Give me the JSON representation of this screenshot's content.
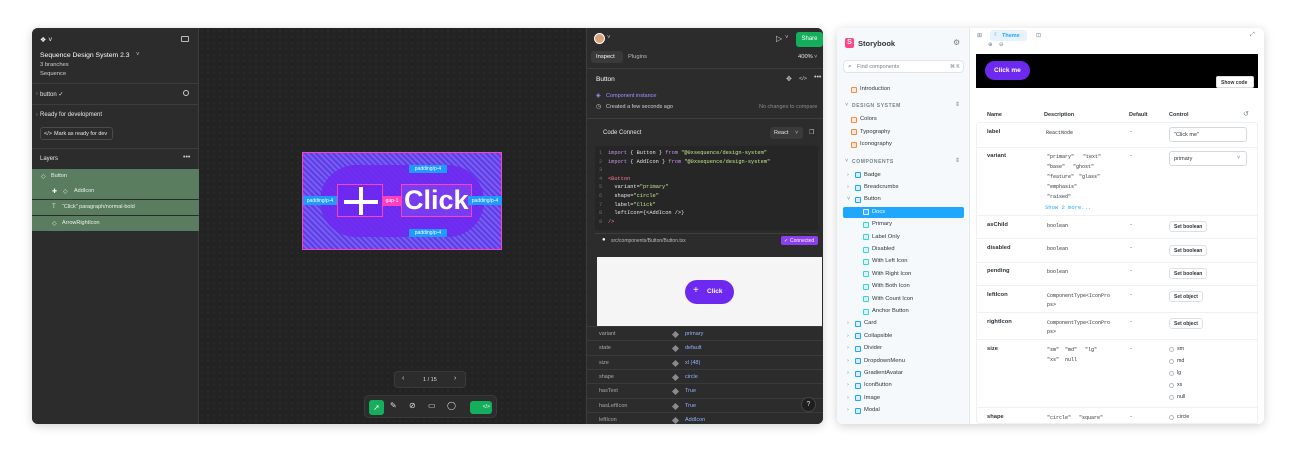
{
  "figma": {
    "file_title": "Sequence Design System 2.3",
    "branches": "3 branches",
    "team": "Sequence",
    "page": "button ✓",
    "ready_title": "Ready for development",
    "mark_ready": "Mark as ready for dev",
    "layers_title": "Layers",
    "layers": [
      "Button",
      "AddIcon",
      "“Click” paragraph/normal-bold",
      "ArrowRightIcon"
    ],
    "canvas": {
      "label_click": "Click",
      "pad_top": "padding/p-4",
      "pad_left": "padding/p-4",
      "pad_right": "padding/p-4",
      "pad_bottom": "padding/p-4",
      "gap": "gap-1",
      "pager": "1 / 15"
    },
    "zoom": "400%",
    "share": "Share",
    "tabs": [
      "Inspect",
      "Plugins"
    ],
    "component": "Button",
    "instance": "Component instance",
    "created": "Created a few seconds ago",
    "no_changes": "No changes to compare",
    "code_connect": "Code Connect",
    "lang": "React",
    "code_lines": [
      {
        "n": "1",
        "parts": [
          [
            "import",
            "#c792ea"
          ],
          [
            " { Button } ",
            "#e6e6e6"
          ],
          [
            "from",
            "#c792ea"
          ],
          [
            " \"@0xsequence/design-system\"",
            "#c3e88d"
          ]
        ]
      },
      {
        "n": "2",
        "parts": [
          [
            "import",
            "#c792ea"
          ],
          [
            " { AddIcon } ",
            "#e6e6e6"
          ],
          [
            "from",
            "#c792ea"
          ],
          [
            " \"@0xsequence/design-system\"",
            "#c3e88d"
          ]
        ]
      },
      {
        "n": "3",
        "parts": []
      },
      {
        "n": "4",
        "parts": [
          [
            "<Button",
            "#ff7b9c"
          ]
        ]
      },
      {
        "n": "5",
        "parts": [
          [
            "  variant=",
            "#e6e6e6"
          ],
          [
            "\"primary\"",
            "#c3e88d"
          ]
        ]
      },
      {
        "n": "6",
        "parts": [
          [
            "  shape=",
            "#e6e6e6"
          ],
          [
            "\"circle\"",
            "#c3e88d"
          ]
        ]
      },
      {
        "n": "7",
        "parts": [
          [
            "  label=",
            "#e6e6e6"
          ],
          [
            "\"Click\"",
            "#c3e88d"
          ]
        ]
      },
      {
        "n": "8",
        "parts": [
          [
            "  leftIcon={<AddIcon />}",
            "#e6e6e6"
          ]
        ]
      },
      {
        "n": "9",
        "parts": [
          [
            "/>",
            "#ff7b9c"
          ]
        ]
      }
    ],
    "source_path": "src/components/Button/Button.tsx",
    "connected": "Connected",
    "preview_label": "Click",
    "props": [
      [
        "variant",
        "primary"
      ],
      [
        "state",
        "default"
      ],
      [
        "size",
        "xl (48)"
      ],
      [
        "shape",
        "circle"
      ],
      [
        "hasText",
        "True"
      ],
      [
        "hasLeftIcon",
        "True"
      ],
      [
        "leftIcon",
        "AddIcon"
      ]
    ]
  },
  "storybook": {
    "brand": "Storybook",
    "search_placeholder": "Find components",
    "shortcut": "⌘ K",
    "introduction": "Introduction",
    "cat_design": "DESIGN SYSTEM",
    "design_items": [
      "Colors",
      "Typography",
      "Iconography"
    ],
    "cat_components": "COMPONENTS",
    "components_before": [
      "Badge",
      "Breadcrumbs",
      "Button"
    ],
    "button_children": [
      "Docs",
      "Primary",
      "Label Only",
      "Disabled",
      "With Left Icon",
      "With Right Icon",
      "With Both Icon",
      "With Count Icon",
      "Anchor Button"
    ],
    "components_after": [
      "Card",
      "Collapsible",
      "Divider",
      "DropdownMenu",
      "GradientAvatar",
      "IconButton",
      "Image",
      "Modal"
    ],
    "theme": "Theme",
    "preview_button": "Click me",
    "show_code": "Show code",
    "headers": [
      "Name",
      "Description",
      "Default",
      "Control"
    ],
    "rows": {
      "label": {
        "name": "label",
        "desc": "ReactNode",
        "def": "-",
        "ctrl": "\"Click me\""
      },
      "variant": {
        "name": "variant",
        "tags": [
          "\"primary\"",
          "\"text\"",
          "\"base\"",
          "\"ghost\"",
          "\"feature\"",
          "\"glass\"",
          "\"emphasis\"",
          "\"raised\""
        ],
        "more": "Show 2 more...",
        "def": "-",
        "ctrl": "primary"
      },
      "asChild": {
        "name": "asChild",
        "desc": "boolean",
        "def": "-",
        "ctrl": "Set boolean"
      },
      "disabled": {
        "name": "disabled",
        "desc": "boolean",
        "def": "-",
        "ctrl": "Set boolean"
      },
      "pending": {
        "name": "pending",
        "desc": "boolean",
        "def": "-",
        "ctrl": "Set boolean"
      },
      "leftIcon": {
        "name": "leftIcon",
        "desc1": "ComponentType<IconPro",
        "desc2": "ps>",
        "def": "-",
        "ctrl": "Set object"
      },
      "rightIcon": {
        "name": "rightIcon",
        "desc1": "ComponentType<IconPro",
        "desc2": "ps>",
        "def": "-",
        "ctrl": "Set object"
      },
      "size": {
        "name": "size",
        "tags": [
          "\"sm\"",
          "\"md\"",
          "\"lg\"",
          "\"xs\"",
          "null"
        ],
        "def": "-",
        "options": [
          "sm",
          "md",
          "lg",
          "xs",
          "null"
        ]
      },
      "shape": {
        "name": "shape",
        "tags": [
          "\"circle\"",
          "\"square\""
        ],
        "def": "-",
        "option": "circle"
      }
    }
  },
  "colors": {
    "accent": "#6e29f0",
    "sb_accent": "#1ea7fd",
    "figma_green": "#14ae5c",
    "layer_green": "#5b7d5f",
    "connected": "#8b3ff0"
  }
}
